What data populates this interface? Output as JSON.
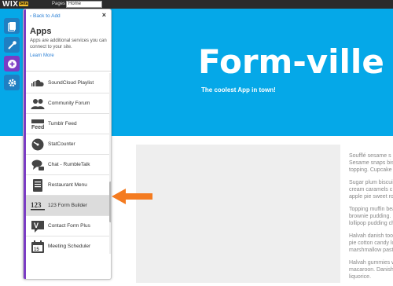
{
  "topbar": {
    "logo": "WIX",
    "badge": "beta",
    "pages_label": "Pages",
    "pages_value": "Home"
  },
  "site": {
    "title": "Form-ville",
    "subtitle": "The coolest App in town!",
    "header_color": "#05a8e8",
    "paragraphs": [
      [
        "Soufflé sesame s",
        "Sesame snaps bis",
        "topping. Cupcake"
      ],
      [
        "Sugar plum biscui",
        "cream caramels c",
        "apple pie sweet ro"
      ],
      [
        "Topping muffin bea",
        "brownie pudding.",
        "lollipop pudding ch"
      ],
      [
        "Halvah danish too",
        "pie cotton candy lo",
        "marshmallow past"
      ],
      [
        "Halvah gummies w",
        "macaroon. Danish",
        "liquorice."
      ]
    ]
  },
  "tools": [
    {
      "icon": "pages-icon"
    },
    {
      "icon": "design-icon"
    },
    {
      "icon": "add-icon"
    },
    {
      "icon": "settings-icon"
    }
  ],
  "panel": {
    "back_label": "Back to Add",
    "close_label": "×",
    "title": "Apps",
    "description": "Apps are additional services you can connect to your site.",
    "learn_more": "Learn More",
    "accent_color": "#7b3cc4",
    "apps": [
      {
        "label": "SoundCloud Playlist",
        "icon": "soundcloud-icon"
      },
      {
        "label": "Community Forum",
        "icon": "forum-icon"
      },
      {
        "label": "Tumblr Feed",
        "icon": "feed-icon"
      },
      {
        "label": "StatCounter",
        "icon": "statcounter-icon"
      },
      {
        "label": "Chat - RumbleTalk",
        "icon": "chat-icon"
      },
      {
        "label": "Restaurant Menu",
        "icon": "menu-icon"
      },
      {
        "label": "123 Form Builder",
        "icon": "form-builder-icon"
      },
      {
        "label": "Contact Form Plus",
        "icon": "contact-form-icon"
      },
      {
        "label": "Meeting Scheduler",
        "icon": "calendar-icon"
      }
    ],
    "highlighted_app": "123 Form Builder"
  },
  "annotation": {
    "arrow_color": "#f47b20"
  }
}
